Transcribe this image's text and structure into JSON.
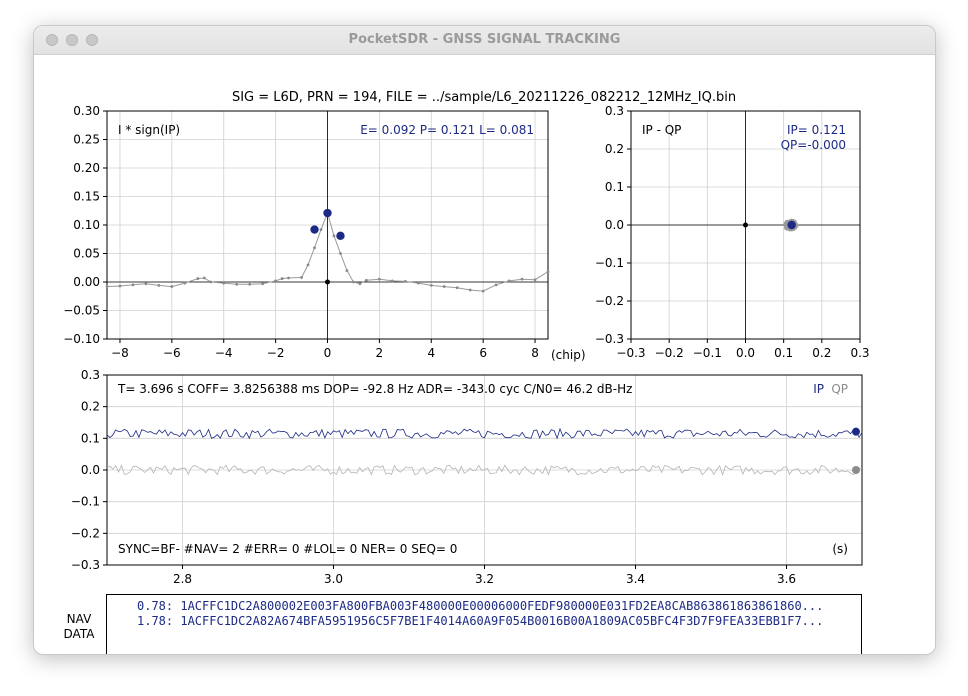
{
  "window": {
    "title": "PocketSDR - GNSS SIGNAL TRACKING",
    "buttons": [
      "close",
      "minimize",
      "zoom"
    ]
  },
  "header": "SIG = L6D, PRN = 194, FILE = ../sample/L6_20211226_082212_12MHz_IQ.bin",
  "colors": {
    "ip": "#1c2a85",
    "qp": "#8c8c8c",
    "axis": "#000000",
    "grid": "#d0d0d0"
  },
  "chart_data": [
    {
      "type": "line",
      "label": "I * sign(IP)",
      "readout": "E= 0.092 P= 0.121 L= 0.081",
      "xlabel": "(chip)",
      "xlim": [
        -8.5,
        8.5
      ],
      "ylim": [
        -0.1,
        0.3
      ],
      "xticks": [
        "−8",
        "−6",
        "−4",
        "−2",
        "0",
        "2",
        "4",
        "6",
        "8"
      ],
      "yticks": [
        "0.30",
        "0.25",
        "0.20",
        "0.15",
        "0.10",
        "0.05",
        "0.00",
        "−0.05",
        "−0.10"
      ],
      "correlator_x": [
        -8.5,
        -8.0,
        -7.5,
        -7.0,
        -6.5,
        -6.0,
        -5.5,
        -5.0,
        -4.75,
        -4.5,
        -4.0,
        -3.5,
        -3.0,
        -2.5,
        -2.0,
        -1.75,
        -1.5,
        -1.0,
        -0.75,
        -0.5,
        -0.25,
        0.0,
        0.25,
        0.5,
        0.75,
        1.0,
        1.25,
        1.5,
        2.0,
        2.5,
        3.0,
        3.5,
        4.0,
        4.5,
        5.0,
        5.5,
        6.0,
        6.5,
        7.0,
        7.5,
        8.0,
        8.5
      ],
      "correlator_y": [
        -0.008,
        -0.007,
        -0.005,
        -0.003,
        -0.006,
        -0.008,
        -0.002,
        0.006,
        0.007,
        0.0,
        -0.002,
        -0.004,
        -0.004,
        -0.003,
        0.002,
        0.006,
        0.007,
        0.008,
        0.03,
        0.06,
        0.092,
        0.121,
        0.081,
        0.05,
        0.02,
        0.0,
        -0.003,
        0.003,
        0.005,
        0.002,
        0.001,
        -0.002,
        -0.006,
        -0.008,
        -0.01,
        -0.014,
        -0.016,
        -0.005,
        0.002,
        0.005,
        0.004,
        0.018
      ],
      "epl_x": [
        -0.5,
        0.0,
        0.5
      ],
      "epl_y": [
        0.092,
        0.121,
        0.081
      ],
      "origin_marker": [
        0.0,
        0.0
      ]
    },
    {
      "type": "scatter",
      "label": "IP - QP",
      "readout_ip": "IP= 0.121",
      "readout_qp": "QP=-0.000",
      "xlim": [
        -0.3,
        0.3
      ],
      "ylim": [
        -0.3,
        0.3
      ],
      "xticks": [
        "−0.3",
        "−0.2",
        "−0.1",
        "0.0",
        "0.1",
        "0.2",
        "0.3"
      ],
      "yticks": [
        "0.3",
        "0.2",
        "0.1",
        "0.0",
        "−0.1",
        "−0.2",
        "−0.3"
      ],
      "cluster_center": [
        0.118,
        0.0
      ],
      "current_point": [
        0.121,
        0.0
      ],
      "origin_marker": [
        0.0,
        0.0
      ]
    },
    {
      "type": "line",
      "info": "T=  3.696 s COFF= 3.8256388 ms DOP=   -92.8 Hz ADR=    -343.0 cyc C/N0= 46.2 dB-Hz",
      "sync": "SYNC=BF- #NAV=   2 #ERR= 0 #LOL= 0 NER= 0 SEQ=     0",
      "unit": "(s)",
      "xlim": [
        2.7,
        3.7
      ],
      "ylim": [
        -0.3,
        0.3
      ],
      "xticks": [
        "2.8",
        "3.0",
        "3.2",
        "3.4",
        "3.6"
      ],
      "yticks": [
        "0.3",
        "0.2",
        "0.1",
        "0.0",
        "−0.1",
        "−0.2",
        "−0.3"
      ],
      "series": [
        {
          "name": "IP",
          "mean": 0.115,
          "last": 0.121
        },
        {
          "name": "QP",
          "mean": 0.0,
          "last": 0.0
        }
      ]
    }
  ],
  "nav": {
    "label_line1": "NAV",
    "label_line2": "DATA",
    "lines": [
      "0.78: 1ACFFC1DC2A800002E003FA800FBA003F480000E00006000FEDF980000E031FD2EA8CAB863861863861860...",
      "1.78: 1ACFFC1DC2A82A674BFA5951956C5F7BE1F4014A60A9F054B0016B00A1809AC05BFC4F3D7F9FEA33EBB1F7..."
    ]
  }
}
